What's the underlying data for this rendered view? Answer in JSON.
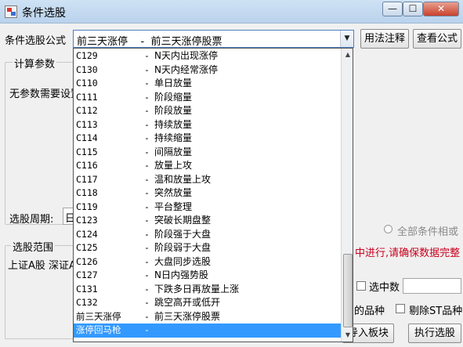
{
  "window": {
    "title": "条件选股",
    "minimize_glyph": "—",
    "maximize_glyph": "☐",
    "close_glyph": "✕"
  },
  "formula": {
    "label": "条件选股公式",
    "selected_value": "前三天涨停    -  前三天涨停股票",
    "usage_button": "用法注释",
    "view_button": "查看公式"
  },
  "params": {
    "group_title": "计算参数",
    "no_params_text": "无参数需要设置"
  },
  "period": {
    "label": "选股周期:",
    "value": "日线"
  },
  "all_conditions_label": "全部条件相或",
  "scope": {
    "group_title": "选股范围",
    "items_text": "上证A股 深证A股"
  },
  "warning_text": "中进行,请确保数据完整",
  "select_count_label": "选中数",
  "species_label": "的品种",
  "exclude_st_label": "剔除ST品种",
  "import_block_button": "导入板块",
  "execute_button": "执行选股",
  "dropdown": {
    "items": [
      {
        "code": "C129",
        "desc": "N天内出现涨停"
      },
      {
        "code": "C130",
        "desc": "N天内经常涨停"
      },
      {
        "code": "C110",
        "desc": "单日放量"
      },
      {
        "code": "C111",
        "desc": "阶段缩量"
      },
      {
        "code": "C112",
        "desc": "阶段放量"
      },
      {
        "code": "C113",
        "desc": "持续放量"
      },
      {
        "code": "C114",
        "desc": "持续缩量"
      },
      {
        "code": "C115",
        "desc": "间隔放量"
      },
      {
        "code": "C116",
        "desc": "放量上攻"
      },
      {
        "code": "C117",
        "desc": "温和放量上攻"
      },
      {
        "code": "C118",
        "desc": "突然放量"
      },
      {
        "code": "C119",
        "desc": "平台整理"
      },
      {
        "code": "C123",
        "desc": "突破长期盘整"
      },
      {
        "code": "C124",
        "desc": "阶段强于大盘"
      },
      {
        "code": "C125",
        "desc": "阶段弱于大盘"
      },
      {
        "code": "C126",
        "desc": "大盘同步选股"
      },
      {
        "code": "C127",
        "desc": "N日内强势股"
      },
      {
        "code": "C131",
        "desc": "下跌多日再放量上涨"
      },
      {
        "code": "C132",
        "desc": "跳空高开或低开"
      },
      {
        "code": "前三天涨停",
        "desc": "前三天涨停股票"
      },
      {
        "code": "涨停回马枪",
        "desc": ""
      }
    ],
    "separator": "-",
    "selected_index": 20,
    "scroll_up_glyph": "▲",
    "scroll_down_glyph": "▼",
    "combo_arrow_glyph": "▼"
  }
}
